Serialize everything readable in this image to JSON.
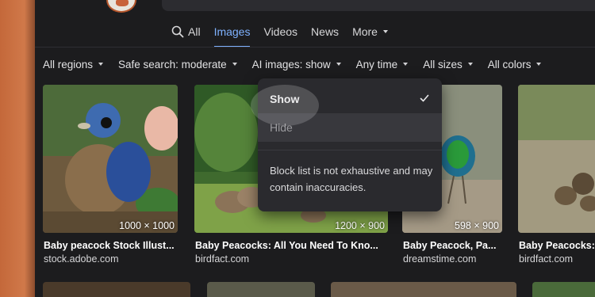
{
  "tabs": [
    {
      "label": "All",
      "icon": "search-icon"
    },
    {
      "label": "Images"
    },
    {
      "label": "Videos"
    },
    {
      "label": "News"
    },
    {
      "label": "More"
    }
  ],
  "filters": [
    "All regions",
    "Safe search: moderate",
    "AI images: show",
    "Any time",
    "All sizes",
    "All colors"
  ],
  "cards": [
    {
      "title": "Baby peacock Stock Illust...",
      "source": "stock.adobe.com",
      "dims": "1000 × 1000"
    },
    {
      "title": "Baby Peacocks: All You Need To Kno...",
      "source": "birdfact.com",
      "dims": "1200 × 900"
    },
    {
      "title": "Baby Peacock, Pa...",
      "source": "dreamstime.com",
      "dims": "598 × 900"
    },
    {
      "title": "Baby Peacocks:",
      "source": "birdfact.com",
      "dims": ""
    }
  ],
  "ai_menu": {
    "show_label": "Show",
    "hide_label": "Hide",
    "note": "Block list is not exhaustive and may contain inaccuracies.",
    "selected": "Show"
  },
  "colors": {
    "accent": "#7fb2ff",
    "background": "#1c1c1e",
    "menu": "#2a2a2e"
  }
}
